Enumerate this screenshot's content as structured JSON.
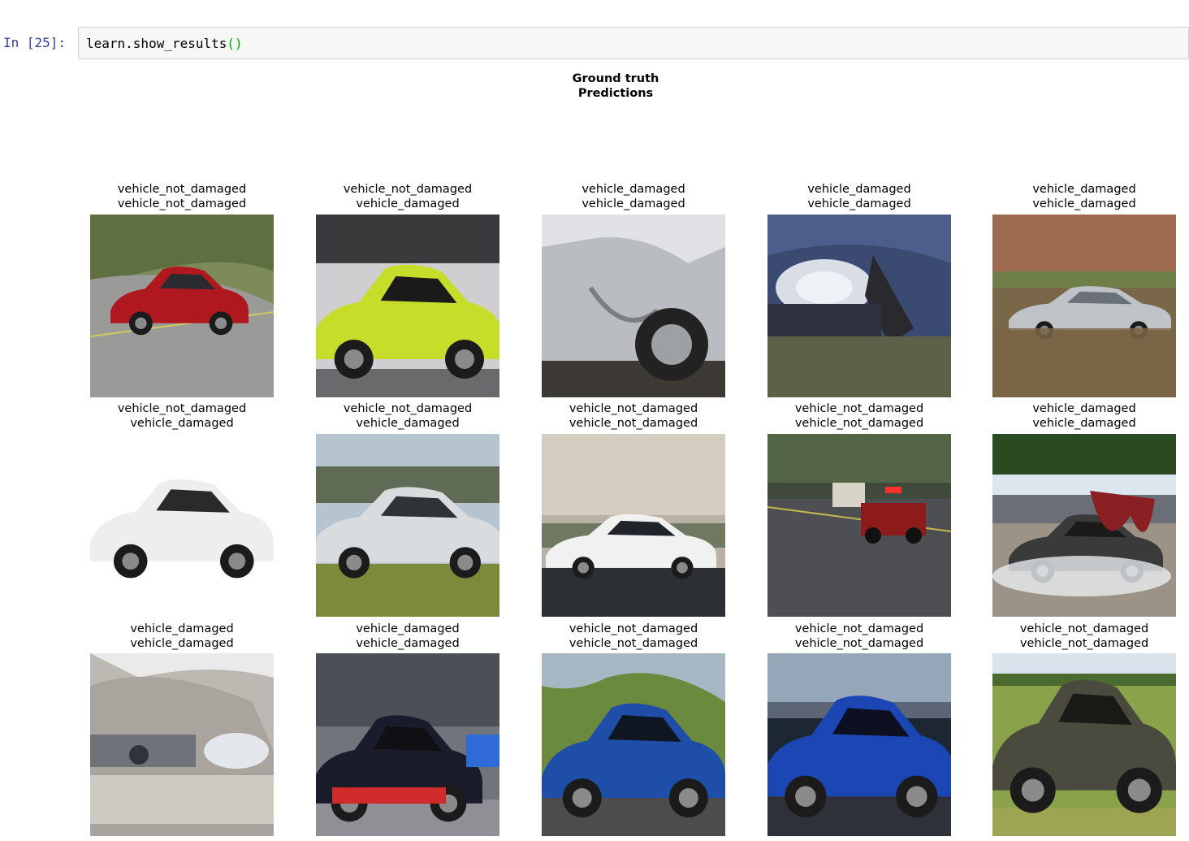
{
  "cell": {
    "prompt": "In [25]:",
    "code_obj": "learn.show_results",
    "code_call": "()"
  },
  "figure": {
    "title_line1": "Ground truth",
    "title_line2": "Predictions"
  },
  "results": [
    {
      "truth": "vehicle_not_damaged",
      "prediction": "vehicle_not_damaged",
      "scene": "red-hatchback-on-road"
    },
    {
      "truth": "vehicle_not_damaged",
      "prediction": "vehicle_damaged",
      "scene": "lime-supercar-studio"
    },
    {
      "truth": "vehicle_damaged",
      "prediction": "vehicle_damaged",
      "scene": "dented-silver-car-side"
    },
    {
      "truth": "vehicle_damaged",
      "prediction": "vehicle_damaged",
      "scene": "crashed-front-headlight"
    },
    {
      "truth": "vehicle_damaged",
      "prediction": "vehicle_damaged",
      "scene": "flooded-silver-sedan"
    },
    {
      "truth": "vehicle_not_damaged",
      "prediction": "vehicle_damaged",
      "scene": "white-sports-car"
    },
    {
      "truth": "vehicle_not_damaged",
      "prediction": "vehicle_damaged",
      "scene": "silver-hypercar-on-grass"
    },
    {
      "truth": "vehicle_not_damaged",
      "prediction": "vehicle_not_damaged",
      "scene": "white-ev-on-track"
    },
    {
      "truth": "vehicle_not_damaged",
      "prediction": "vehicle_not_damaged",
      "scene": "fire-truck-at-intersection"
    },
    {
      "truth": "vehicle_damaged",
      "prediction": "vehicle_damaged",
      "scene": "burned-car-with-foam"
    },
    {
      "truth": "vehicle_damaged",
      "prediction": "vehicle_damaged",
      "scene": "wrecked-front-end"
    },
    {
      "truth": "vehicle_damaged",
      "prediction": "vehicle_damaged",
      "scene": "wrecked-race-car"
    },
    {
      "truth": "vehicle_not_damaged",
      "prediction": "vehicle_not_damaged",
      "scene": "blue-sedan-mountain-road"
    },
    {
      "truth": "vehicle_not_damaged",
      "prediction": "vehicle_not_damaged",
      "scene": "blue-coupe-sunset"
    },
    {
      "truth": "vehicle_not_damaged",
      "prediction": "vehicle_not_damaged",
      "scene": "grey-roadster-on-grass"
    }
  ]
}
